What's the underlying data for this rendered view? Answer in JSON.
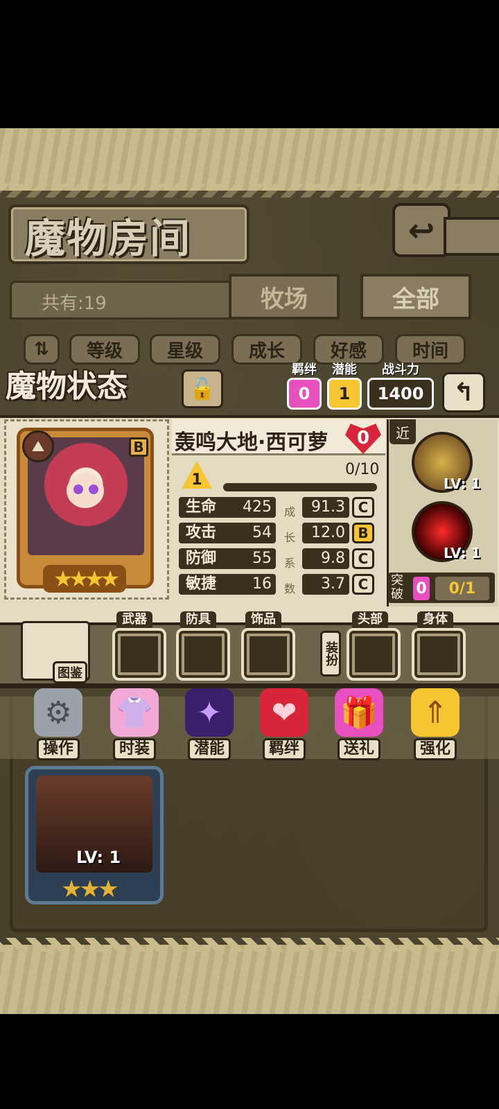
{
  "header": {
    "title": "魔物房间"
  },
  "collection": {
    "count_label": "共有:19"
  },
  "tabs": [
    {
      "label": "牧场"
    },
    {
      "label": "全部"
    }
  ],
  "sort_buttons": [
    {
      "label": "等级"
    },
    {
      "label": "星级"
    },
    {
      "label": "成长"
    },
    {
      "label": "好感"
    },
    {
      "label": "时间"
    }
  ],
  "status": {
    "title": "魔物状态",
    "bond": {
      "label": "羁绊",
      "value": "0"
    },
    "potential": {
      "label": "潜能",
      "value": "1"
    },
    "power": {
      "label": "战斗力",
      "value": "1400"
    }
  },
  "monster": {
    "name": "轰鸣大地·西可萝",
    "affinity": "0",
    "rank": "B",
    "stars": 4,
    "level": "1",
    "exp": "0/10",
    "growth_label": [
      "成",
      "长",
      "系",
      "数"
    ],
    "stats": [
      {
        "name": "生命",
        "value": "425",
        "growth": "91.3",
        "grade": "C"
      },
      {
        "name": "攻击",
        "value": "54",
        "growth": "12.0",
        "grade": "B"
      },
      {
        "name": "防御",
        "value": "55",
        "growth": "9.8",
        "grade": "C"
      },
      {
        "name": "敏捷",
        "value": "16",
        "growth": "3.7",
        "grade": "C"
      }
    ]
  },
  "skills": {
    "range_tag": "近",
    "items": [
      {
        "level": "LV: 1"
      },
      {
        "level": "LV: 1"
      }
    ],
    "breakthrough_label": "突破",
    "breakthrough_count": "0",
    "breakthrough_ratio": "0/1"
  },
  "equipment": {
    "codex_label": "图鉴",
    "dress_label": "装扮",
    "slots": [
      {
        "label": "武器"
      },
      {
        "label": "防具"
      },
      {
        "label": "饰品"
      },
      {
        "label": "头部"
      },
      {
        "label": "身体"
      }
    ]
  },
  "actions": [
    {
      "label": "操作",
      "icon": "gear-icon"
    },
    {
      "label": "时装",
      "icon": "outfit-icon"
    },
    {
      "label": "潜能",
      "icon": "demon-icon"
    },
    {
      "label": "羁绊",
      "icon": "hearts-icon"
    },
    {
      "label": "送礼",
      "icon": "gift-icon"
    },
    {
      "label": "强化",
      "icon": "upgrade-arrows-icon"
    }
  ],
  "roster_card": {
    "level": "LV: 1",
    "stars": 3
  },
  "colors": {
    "grade_c": "#e8dfc7",
    "grade_b": "#f6c531",
    "accent_pink": "#e84fbf",
    "heart_red": "#d9253a"
  }
}
